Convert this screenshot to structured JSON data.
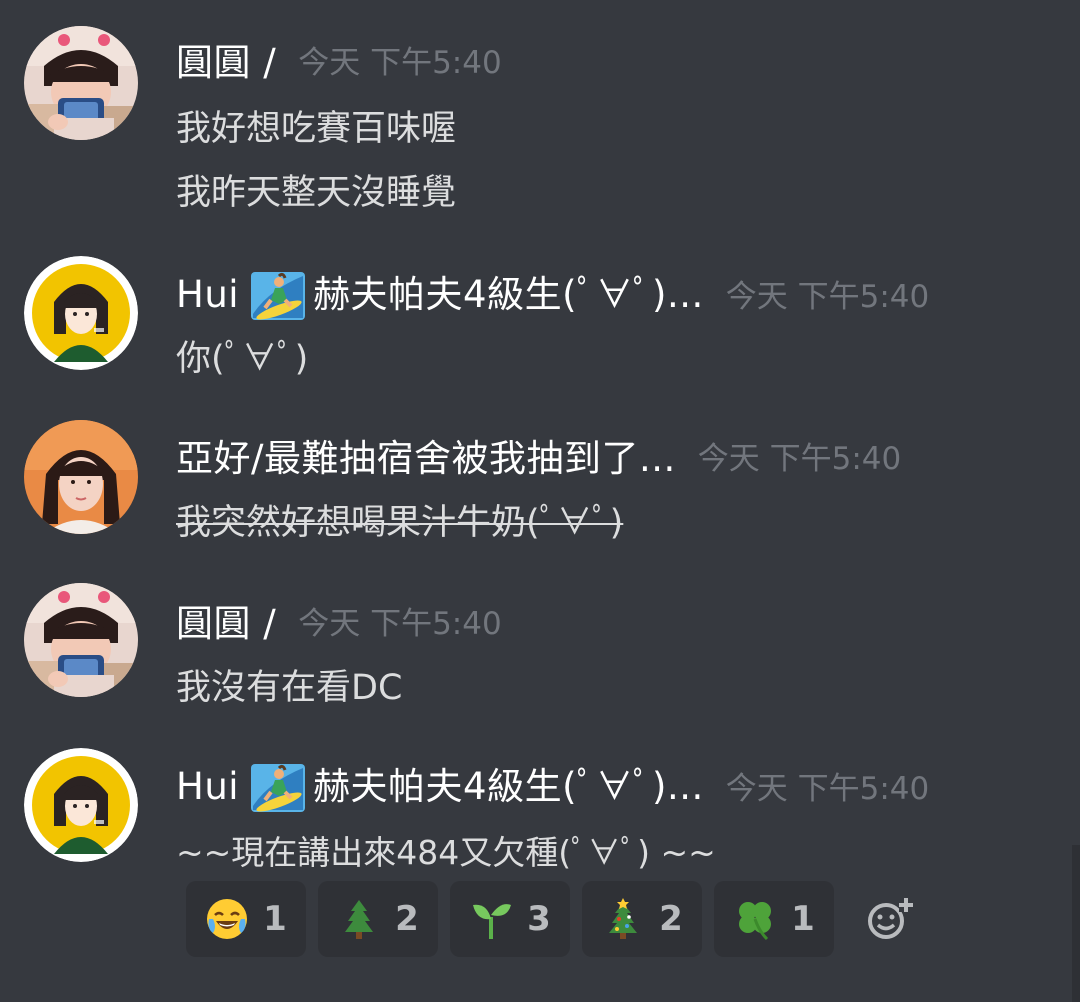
{
  "messages": [
    {
      "username": "圓圓 /",
      "timestamp": "今天 下午5:40",
      "lines": [
        "我好想吃賽百味喔",
        "我昨天整天沒睡覺"
      ]
    },
    {
      "username_pre": "Hui",
      "username_post": "赫夫帕夫4級生(ﾟ∀ﾟ)...",
      "timestamp": "今天 下午5:40",
      "lines": [
        "你(ﾟ∀ﾟ)"
      ]
    },
    {
      "username": "亞好/最難抽宿舍被我抽到了...",
      "timestamp": "今天 下午5:40",
      "lines": [
        "我突然好想喝果汁牛奶(ﾟ∀ﾟ)"
      ]
    },
    {
      "username": "圓圓 /",
      "timestamp": "今天 下午5:40",
      "lines": [
        "我沒有在看DC"
      ]
    },
    {
      "username_pre": "Hui",
      "username_post": "赫夫帕夫4級生(ﾟ∀ﾟ)...",
      "timestamp": "今天 下午5:40",
      "lines": [
        "~~現在講出來484又欠種(ﾟ∀ﾟ) ~~"
      ]
    }
  ],
  "reactions": [
    {
      "emoji": "joy",
      "count": "1"
    },
    {
      "emoji": "evergreen-tree",
      "count": "2"
    },
    {
      "emoji": "seedling",
      "count": "3"
    },
    {
      "emoji": "christmas-tree",
      "count": "2"
    },
    {
      "emoji": "four-leaf-clover",
      "count": "1"
    }
  ],
  "colors": {
    "background": "#36393f",
    "username": "#ffffff",
    "timestamp": "#72767d",
    "text": "#dcddde",
    "reaction_bg": "#2f3136",
    "reaction_count": "#b9bbbe"
  }
}
